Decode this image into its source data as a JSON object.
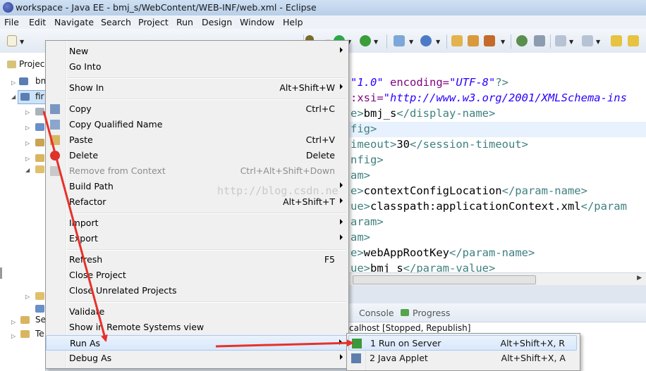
{
  "window": {
    "title": "workspace - Java EE - bmj_s/WebContent/WEB-INF/web.xml - Eclipse"
  },
  "menubar": [
    "File",
    "Edit",
    "Navigate",
    "Search",
    "Project",
    "Run",
    "Design",
    "Window",
    "Help"
  ],
  "explorer": {
    "tab_label": "Projec",
    "rows": [
      "bn",
      "fir",
      "Se",
      "Te"
    ]
  },
  "editor": {
    "lines": [
      {
        "parts": [
          {
            "t": "\"1.0\"",
            "c": "str"
          },
          {
            "t": " encoding=",
            "c": "attr"
          },
          {
            "t": "\"UTF-8\"",
            "c": "str"
          },
          {
            "t": "?>",
            "c": "tag"
          }
        ]
      },
      {
        "parts": [
          {
            "t": ":xsi=",
            "c": "attr"
          },
          {
            "t": "\"http://www.w3.org/2001/XMLSchema-ins",
            "c": "str"
          }
        ]
      },
      {
        "parts": [
          {
            "t": "e>",
            "c": "tag"
          },
          {
            "t": "bmj_s",
            "c": "txt"
          },
          {
            "t": "</display-name>",
            "c": "tag"
          }
        ]
      },
      {
        "parts": [
          {
            "t": "fig>",
            "c": "tag"
          }
        ]
      },
      {
        "parts": [
          {
            "t": "imeout>",
            "c": "tag"
          },
          {
            "t": "30",
            "c": "txt"
          },
          {
            "t": "</session-timeout>",
            "c": "tag"
          }
        ]
      },
      {
        "parts": [
          {
            "t": "nfig>",
            "c": "tag"
          }
        ]
      },
      {
        "parts": [
          {
            "t": "am>",
            "c": "tag"
          }
        ]
      },
      {
        "parts": [
          {
            "t": "e>",
            "c": "tag"
          },
          {
            "t": "contextConfigLocation",
            "c": "txt"
          },
          {
            "t": "</param-name>",
            "c": "tag"
          }
        ]
      },
      {
        "parts": [
          {
            "t": "ue>",
            "c": "tag"
          },
          {
            "t": "classpath:applicationContext.xml",
            "c": "txt"
          },
          {
            "t": "</param",
            "c": "tag"
          }
        ]
      },
      {
        "parts": [
          {
            "t": "aram>",
            "c": "tag"
          }
        ]
      },
      {
        "parts": [
          {
            "t": "am>",
            "c": "tag"
          }
        ]
      },
      {
        "parts": [
          {
            "t": "e>",
            "c": "tag"
          },
          {
            "t": "webAppRootKey",
            "c": "txt"
          },
          {
            "t": "</param-name>",
            "c": "tag"
          }
        ]
      },
      {
        "parts": [
          {
            "t": "ue>",
            "c": "tag"
          },
          {
            "t": "bmj_s",
            "c": "txt"
          },
          {
            "t": "</param-value>",
            "c": "tag"
          }
        ]
      }
    ]
  },
  "bottom_panel": {
    "tabs": [
      "Console",
      "Progress"
    ],
    "server_line": "calhost  [Stopped, Republish]"
  },
  "context_menu": {
    "items": [
      {
        "label": "New",
        "shortcut": "",
        "submenu": true
      },
      {
        "label": "Go Into",
        "shortcut": ""
      },
      {
        "sep": true
      },
      {
        "label": "Show In",
        "shortcut": "Alt+Shift+W",
        "submenu": true
      },
      {
        "sep": true
      },
      {
        "label": "Copy",
        "shortcut": "Ctrl+C",
        "icon": "copy"
      },
      {
        "label": "Copy Qualified Name",
        "shortcut": "",
        "icon": "copy-qualified"
      },
      {
        "label": "Paste",
        "shortcut": "Ctrl+V",
        "icon": "paste"
      },
      {
        "label": "Delete",
        "shortcut": "Delete",
        "icon": "delete"
      },
      {
        "label": "Remove from Context",
        "shortcut": "Ctrl+Alt+Shift+Down",
        "disabled": true,
        "icon": "remove-context"
      },
      {
        "label": "Build Path",
        "shortcut": "",
        "submenu": true
      },
      {
        "label": "Refactor",
        "shortcut": "Alt+Shift+T",
        "submenu": true
      },
      {
        "sep": true
      },
      {
        "label": "Import",
        "shortcut": "",
        "submenu": true
      },
      {
        "label": "Export",
        "shortcut": "",
        "submenu": true
      },
      {
        "sep": true
      },
      {
        "label": "Refresh",
        "shortcut": "F5"
      },
      {
        "label": "Close Project",
        "shortcut": ""
      },
      {
        "label": "Close Unrelated Projects",
        "shortcut": ""
      },
      {
        "sep": true
      },
      {
        "label": "Validate",
        "shortcut": ""
      },
      {
        "label": "Show in Remote Systems view",
        "shortcut": ""
      },
      {
        "label": "Run As",
        "shortcut": "",
        "submenu": true,
        "active": true
      },
      {
        "label": "Debug As",
        "shortcut": "",
        "submenu": true
      }
    ]
  },
  "run_as_submenu": {
    "items": [
      {
        "label": "1 Run on Server",
        "shortcut": "Alt+Shift+X, R",
        "active": true,
        "icon": "run-server"
      },
      {
        "label": "2 Java Applet",
        "shortcut": "Alt+Shift+X, A",
        "icon": "java-applet"
      }
    ]
  },
  "watermark": "http://blog.csdn.ne",
  "colors": {
    "arrow": "#e8302a",
    "highlight": "#d9e8fb",
    "xml_string": "#2a00ff",
    "xml_attr": "#7f007f",
    "xml_tag": "#3f7f7f"
  }
}
